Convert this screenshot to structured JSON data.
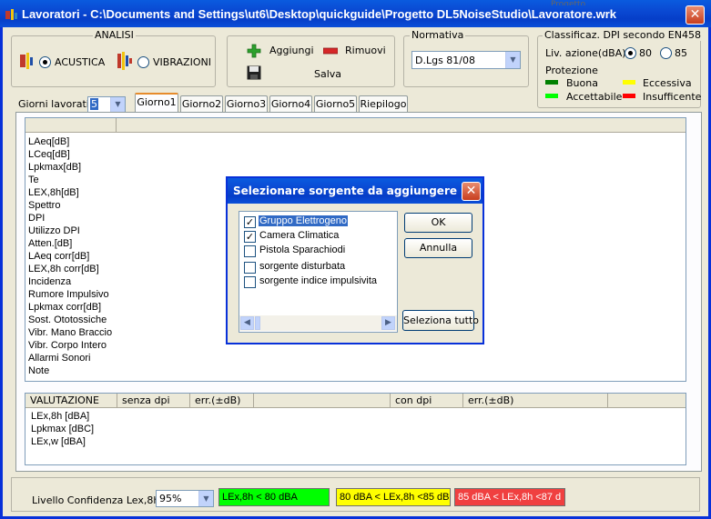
{
  "window": {
    "title": "Lavoratori - C:\\Documents and Settings\\ut6\\Desktop\\quickguide\\Progetto DL5NoiseStudio\\Lavoratore.wrk",
    "close_glyph": "✕",
    "background_peek": "Progetto"
  },
  "analisi": {
    "label": "ANALISI",
    "acustica": "ACUSTICA",
    "vibrazioni": "VIBRAZIONI",
    "selected": "ACUSTICA"
  },
  "actions": {
    "aggiungi": "Aggiungi",
    "rimuovi": "Rimuovi",
    "salva": "Salva"
  },
  "normativa": {
    "label": "Normativa",
    "value": "D.Lgs 81/08"
  },
  "classificazione": {
    "label": "Classificaz. DPI secondo EN458",
    "livello_label": "Liv. azione(dBA)",
    "option_80": "80",
    "option_85": "85",
    "selected": "80",
    "protezione_label": "Protezione",
    "legend": [
      {
        "label": "Buona",
        "color": "#008000"
      },
      {
        "label": "Eccessiva",
        "color": "#ffff00"
      },
      {
        "label": "Accettabile",
        "color": "#00ff00"
      },
      {
        "label": "Insufficente",
        "color": "#ff0000"
      }
    ]
  },
  "giorni": {
    "label": "Giorni lavorativi",
    "value": "5"
  },
  "tabs": [
    "Giorno1",
    "Giorno2",
    "Giorno3",
    "Giorno4",
    "Giorno5",
    "Riepilogo"
  ],
  "active_tab": "Giorno1",
  "params": [
    "LAeq[dB]",
    "LCeq[dB]",
    "Lpkmax[dB]",
    "Te",
    "LEX,8h[dB]",
    "Spettro",
    "DPI",
    "Utilizzo DPI",
    "Atten.[dB]",
    "LAeq corr[dB]",
    "LEX,8h corr[dB]",
    "Incidenza",
    "Rumore Impulsivo",
    "Lpkmax corr[dB]",
    "Sost. Ototossiche",
    "Vibr. Mano Braccio",
    "Vibr. Corpo Intero",
    "Allarmi Sonori",
    "Note"
  ],
  "valutazione": {
    "headers": [
      "VALUTAZIONE",
      "senza dpi",
      "err.(±dB)",
      "",
      "con dpi",
      "err.(±dB)",
      ""
    ],
    "rows": [
      "LEx,8h [dBA]",
      "Lpkmax [dBC]",
      "LEx,w [dBA]"
    ]
  },
  "footer": {
    "confidenza_label": "Livello Confidenza Lex,8h",
    "confidenza_value": "95%",
    "ranges": [
      {
        "label": "LEx,8h < 80 dBA",
        "color": "#00ff00"
      },
      {
        "label": "80 dBA < LEx,8h <85 dB",
        "color": "#ffff00"
      },
      {
        "label": "85 dBA < LEx,8h <87 d",
        "color": "#f04040"
      }
    ]
  },
  "dialog": {
    "title": "Selezionare sorgente da aggiungere",
    "close_glyph": "✕",
    "items": [
      {
        "label": "Gruppo Elettrogeno",
        "checked": true,
        "selected": true
      },
      {
        "label": "Camera Climatica",
        "checked": true,
        "selected": false
      },
      {
        "label": "Pistola Sparachiodi",
        "checked": false,
        "selected": false
      },
      {
        "label": "sorgente disturbata",
        "checked": false,
        "selected": false
      },
      {
        "label": "sorgente indice impulsivita",
        "checked": false,
        "selected": false
      }
    ],
    "ok": "OK",
    "annulla": "Annulla",
    "seleziona_tutto": "Seleziona tutto"
  }
}
